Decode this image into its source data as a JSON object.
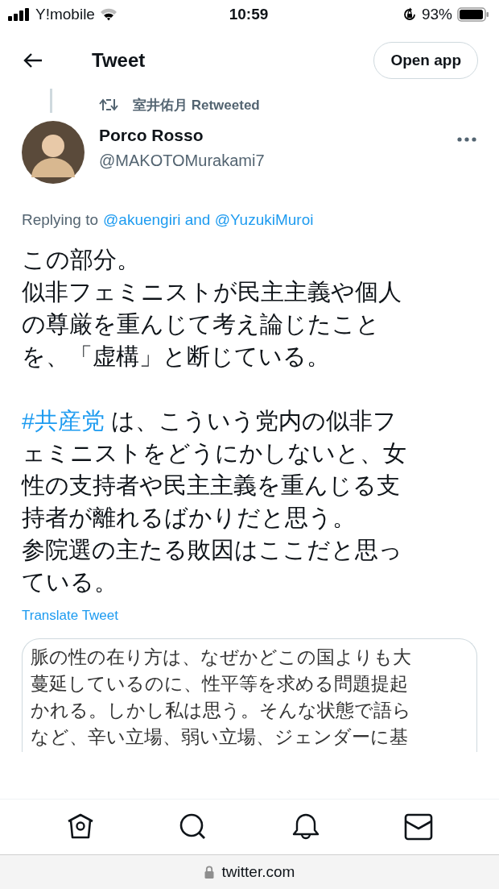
{
  "status_bar": {
    "carrier": "Y!mobile",
    "time": "10:59",
    "battery": "93%"
  },
  "header": {
    "title": "Tweet",
    "open_app": "Open app"
  },
  "retweet": {
    "by": "室井佑月 Retweeted"
  },
  "author": {
    "name": "Porco Rosso",
    "handle": "@MAKOTOMurakami7"
  },
  "replying": {
    "prefix": "Replying to",
    "users": "@akuengiri and @YuzukiMuroi"
  },
  "paragraphs": [
    {
      "lines": [
        "この部分。",
        "似非フェミニストが民主主義や個人",
        "の尊厳を重んじて考え論じたこと",
        "を、「虚構」と断じている。"
      ]
    },
    {
      "hashtag": "#共産党",
      "lines": [
        " は、こういう党内の似非フ",
        "ェミニストをどうにかしないと、女",
        "性の支持者や民主主義を重んじる支",
        "持者が離れるばかりだと思う。",
        "参院選の主たる敗因はここだと思っ",
        "ている。"
      ]
    }
  ],
  "translate": "Translate Tweet",
  "image_text": [
    "脈の性の在り方は、なぜかどこの国よりも大",
    "蔓延しているのに、性平等を求める問題提起",
    "かれる。しかし私は思う。そんな状態で語ら",
    "など、辛い立場、弱い立場、ジェンダーに基"
  ],
  "url": "twitter.com"
}
